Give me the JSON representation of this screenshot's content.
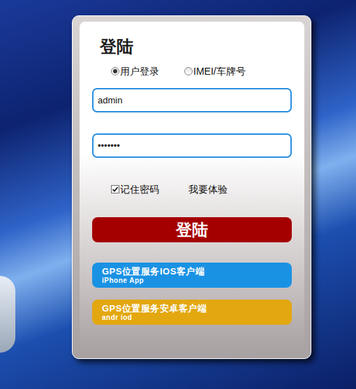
{
  "title": "登陆",
  "login_modes": [
    {
      "label": "用户登录",
      "selected": true
    },
    {
      "label": "IMEI/车牌号",
      "selected": false
    }
  ],
  "username": {
    "value": "admin"
  },
  "password": {
    "value": "•••••••"
  },
  "remember": {
    "label": "记住密码",
    "checked": true
  },
  "trial": {
    "label": "我要体验"
  },
  "login_button": {
    "label": "登陆"
  },
  "app_links": [
    {
      "title": "GPS位置服务IOS客户端",
      "subtitle": "iPhone App",
      "color": "#1a92e4"
    },
    {
      "title": "GPS位置服务安卓客户端",
      "subtitle": "andr iod",
      "color": "#e3a710"
    }
  ]
}
